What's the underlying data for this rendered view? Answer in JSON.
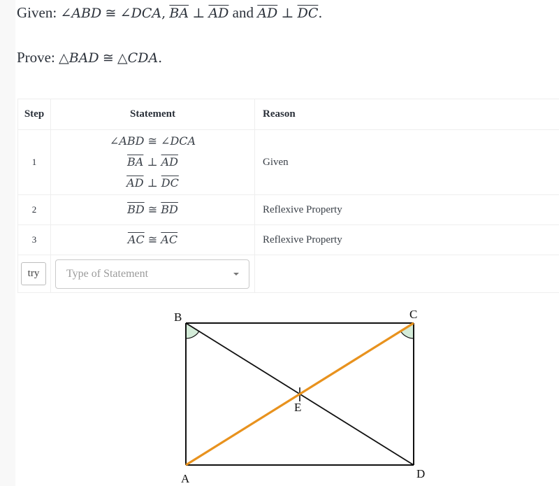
{
  "problem": {
    "given_prefix": "Given:",
    "given_parts": {
      "angle1": "ABD",
      "angle2": "DCA",
      "seg1": "BA",
      "seg2": "AD",
      "and": "and",
      "seg3": "AD",
      "seg4": "DC"
    },
    "prove_prefix": "Prove:",
    "prove_parts": {
      "tri1": "BAD",
      "tri2": "CDA"
    }
  },
  "symbols": {
    "angle": "∠",
    "congruent": "≅",
    "perp": "⊥",
    "triangle": "△",
    "comma": ",",
    "period": "."
  },
  "table": {
    "headers": {
      "step": "Step",
      "statement": "Statement",
      "reason": "Reason"
    },
    "rows": [
      {
        "step": "1",
        "statements": [
          {
            "type": "angle-cong",
            "a": "ABD",
            "b": "DCA"
          },
          {
            "type": "perp",
            "a": "BA",
            "b": "AD"
          },
          {
            "type": "perp",
            "a": "AD",
            "b": "DC"
          }
        ],
        "reason": "Given"
      },
      {
        "step": "2",
        "statements": [
          {
            "type": "seg-cong",
            "a": "BD",
            "b": "BD"
          }
        ],
        "reason": "Reflexive Property"
      },
      {
        "step": "3",
        "statements": [
          {
            "type": "seg-cong",
            "a": "AC",
            "b": "AC"
          }
        ],
        "reason": "Reflexive Property"
      }
    ],
    "input_row": {
      "try_label": "try",
      "select_placeholder": "Type of Statement"
    }
  },
  "diagram": {
    "points": {
      "A": "A",
      "B": "B",
      "C": "C",
      "D": "D",
      "E": "E"
    },
    "highlight_segment": "AC",
    "highlight_color": "#e8921e",
    "angle_marks": [
      "ABD",
      "DCA"
    ],
    "angle_fill": "#d4ecd9",
    "line_color": "#111111"
  }
}
